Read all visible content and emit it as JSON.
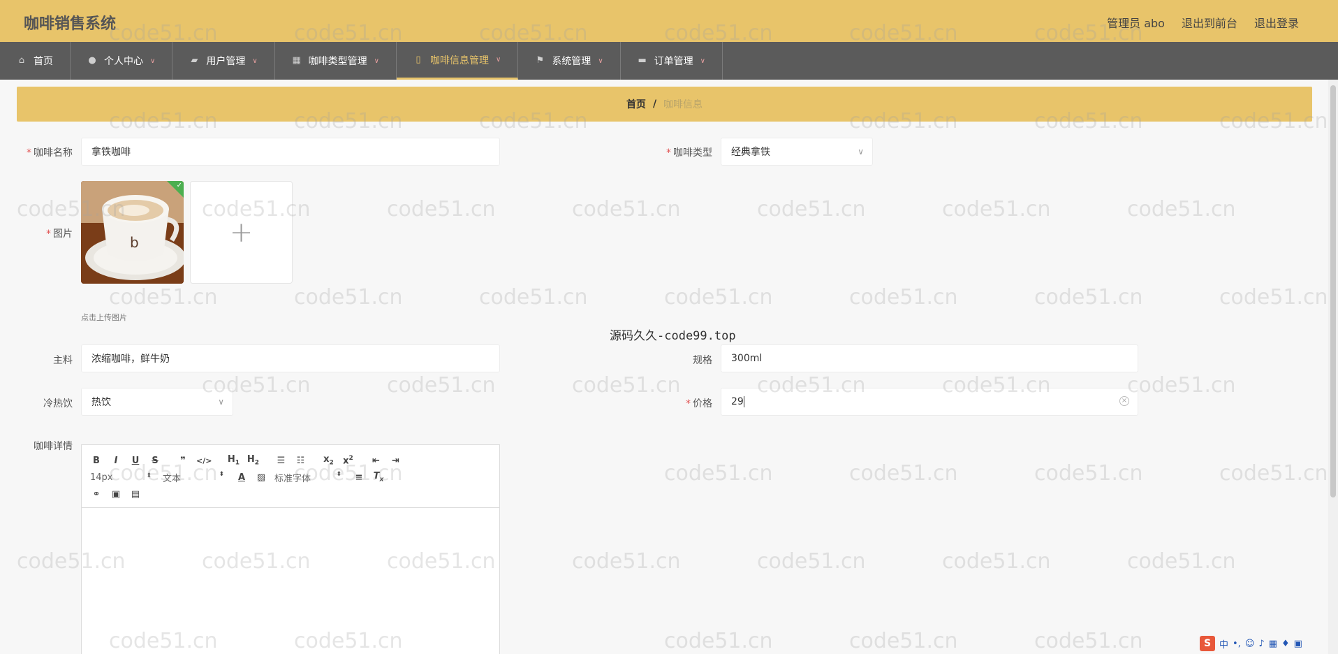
{
  "header": {
    "title": "咖啡销售系统",
    "user_label": "管理员 abo",
    "front_link": "退出到前台",
    "logout_link": "退出登录"
  },
  "nav": {
    "items": [
      {
        "label": "首页",
        "icon": "home-icon",
        "has_dropdown": false
      },
      {
        "label": "个人中心",
        "icon": "user-icon",
        "has_dropdown": true
      },
      {
        "label": "用户管理",
        "icon": "thumbs-icon",
        "has_dropdown": true
      },
      {
        "label": "咖啡类型管理",
        "icon": "grid-icon",
        "has_dropdown": true
      },
      {
        "label": "咖啡信息管理",
        "icon": "mobile-icon",
        "has_dropdown": true,
        "active": true
      },
      {
        "label": "系统管理",
        "icon": "flag-icon",
        "has_dropdown": true
      },
      {
        "label": "订单管理",
        "icon": "chat-icon",
        "has_dropdown": true
      }
    ]
  },
  "breadcrumb": {
    "home": "首页",
    "separator": "/",
    "current": "咖啡信息"
  },
  "form": {
    "name": {
      "label": "咖啡名称",
      "required": true,
      "value": "拿铁咖啡"
    },
    "type": {
      "label": "咖啡类型",
      "required": true,
      "value": "经典拿铁"
    },
    "image": {
      "label": "图片",
      "required": true,
      "upload_tip": "点击上传图片"
    },
    "ingredients": {
      "label": "主料",
      "value": "浓缩咖啡，鲜牛奶"
    },
    "spec": {
      "label": "规格",
      "value": "300ml"
    },
    "temperature": {
      "label": "冷热饮",
      "value": "热饮"
    },
    "price": {
      "label": "价格",
      "required": true,
      "value": "29"
    },
    "details": {
      "label": "咖啡详情"
    }
  },
  "editor": {
    "font_size": "14px",
    "paragraph": "文本",
    "font_family": "标准字体"
  },
  "watermark": {
    "repeated": "code51.cn",
    "center": "源码久久-code99.top"
  },
  "taskbar": {
    "ime_label": "中"
  },
  "colors": {
    "header_bg": "#e8c46a",
    "nav_bg": "#5b5b5b",
    "accent": "#e8c46a",
    "required": "#e05050"
  }
}
